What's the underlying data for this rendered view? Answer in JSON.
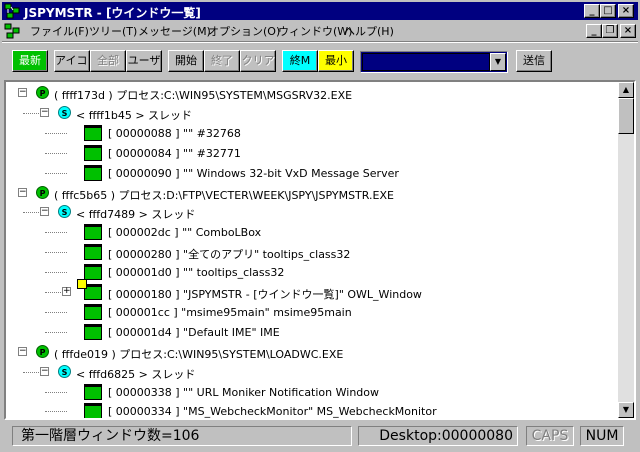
{
  "window": {
    "title": "JSPYMSTR - [ウインドウ一覧]",
    "controls": {
      "minimize": "_",
      "maximize": "□",
      "close": "×"
    },
    "mdi_controls": {
      "minimize": "_",
      "restore": "❐",
      "close": "×"
    }
  },
  "menu": [
    "ファイル(F)",
    "ツリー(T)",
    "メッセージ(M)",
    "オプション(O)",
    "ウィンドウ(W)",
    "ヘルプ(H)"
  ],
  "toolbar": {
    "refresh": "最新",
    "icon": "アイコン",
    "all": "全部",
    "user": "ユーザ",
    "start": "開始",
    "end": "終了",
    "clear": "クリア",
    "endM": "終M",
    "minimize": "最小",
    "combo_value": "",
    "send": "送信"
  },
  "tree": [
    {
      "kind": "process",
      "level": 0,
      "expander": "-",
      "badge": "P",
      "text": "( ffff173d ) プロセス:C:\\WIN95\\SYSTEM\\MSGSRV32.EXE"
    },
    {
      "kind": "thread",
      "level": 1,
      "expander": "-",
      "badge": "S",
      "text": "< ffff1b45 > スレッド"
    },
    {
      "kind": "window",
      "level": 2,
      "text": "[ 00000088 ] \"\" #32768"
    },
    {
      "kind": "window",
      "level": 2,
      "text": "[ 00000084 ] \"\" #32771"
    },
    {
      "kind": "window",
      "level": 2,
      "text": "[ 00000090 ] \"\" Windows 32-bit VxD Message Server"
    },
    {
      "kind": "process",
      "level": 0,
      "expander": "-",
      "badge": "P",
      "text": "( fffc5b65 ) プロセス:D:\\FTP\\VECTER\\WEEK\\JSPY\\JSPYMSTR.EXE"
    },
    {
      "kind": "thread",
      "level": 1,
      "expander": "-",
      "badge": "S",
      "text": "< fffd7489 > スレッド"
    },
    {
      "kind": "window",
      "level": 2,
      "text": "[ 000002dc ] \"\" ComboLBox"
    },
    {
      "kind": "window",
      "level": 2,
      "text": "[ 00000280 ] \"全てのアプリ\" tooltips_class32"
    },
    {
      "kind": "window",
      "level": 2,
      "text": "[ 000001d0 ] \"\" tooltips_class32"
    },
    {
      "kind": "window",
      "level": 2,
      "expander": "+",
      "special": true,
      "text": "[ 00000180 ] \"JSPYMSTR - [ウインドウ一覧]\" OWL_Window"
    },
    {
      "kind": "window",
      "level": 2,
      "text": "[ 000001cc ] \"msime95main\" msime95main"
    },
    {
      "kind": "window",
      "level": 2,
      "text": "[ 000001d4 ] \"Default IME\" IME"
    },
    {
      "kind": "process",
      "level": 0,
      "expander": "-",
      "badge": "P",
      "text": "( fffde019 ) プロセス:C:\\WIN95\\SYSTEM\\LOADWC.EXE"
    },
    {
      "kind": "thread",
      "level": 1,
      "expander": "-",
      "badge": "S",
      "text": "< fffd6825 > スレッド"
    },
    {
      "kind": "window",
      "level": 2,
      "text": "[ 00000338 ] \"\" URL Moniker Notification Window"
    },
    {
      "kind": "window",
      "level": 2,
      "text": "[ 00000334 ] \"MS_WebcheckMonitor\" MS_WebcheckMonitor"
    }
  ],
  "status": {
    "window_count": "第一階層ウィンドウ数=106",
    "desktop": "Desktop:00000080",
    "caps": "CAPS",
    "num": "NUM"
  },
  "colors": {
    "title_bg": "#000080",
    "node_green": "#00c000",
    "node_cyan": "#00ffff",
    "button_yellow": "#ffff00"
  }
}
